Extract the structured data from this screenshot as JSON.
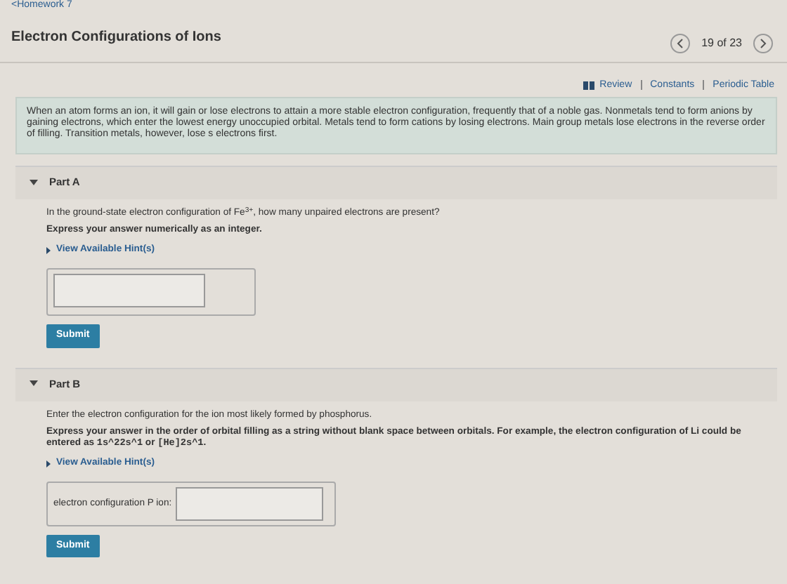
{
  "breadcrumb": "<Homework 7",
  "title": "Electron Configurations of Ions",
  "pager": {
    "position": "19 of 23"
  },
  "links": [
    {
      "label": "Review",
      "kind": "book"
    },
    {
      "label": "Constants",
      "kind": "plain"
    },
    {
      "label": "Periodic Table",
      "kind": "plain"
    }
  ],
  "intro": "When an atom forms an ion, it will gain or lose electrons to attain a more stable electron configuration, frequently that of a noble gas. Nonmetals tend to form anions by gaining electrons, which enter the lowest energy unoccupied orbital. Metals tend to form cations by losing electrons. Main group metals lose electrons in the reverse order of filling. Transition metals, however, lose s electrons first.",
  "parts": [
    {
      "title": "Part A",
      "expanded": true,
      "question": "In the ground-state electron configuration of Fe$^{3+}$, how many unpaired electrons are present?",
      "instruction": [
        {
          "kind": "text",
          "text": "Express your answer numerically as an integer."
        }
      ],
      "hint_link": "View Available Hint(s)",
      "submit": "Submit"
    },
    {
      "title": "Part B",
      "expanded": true,
      "question": "Enter the electron configuration for the ion most likely formed by phosphorus.",
      "instruction": [
        {
          "kind": "text",
          "text": "Express your answer in the order of orbital filling as a string without blank space between orbitals. For example, the electron configuration of Li could be entered as "
        },
        {
          "kind": "code",
          "text": "1s^22s^1"
        },
        {
          "kind": "text",
          "text": " or "
        },
        {
          "kind": "code",
          "text": "[He]2s^1"
        },
        {
          "kind": "text",
          "text": "."
        }
      ],
      "hint_link": "View Available Hint(s)",
      "answer_label": "electron configuration P ion:",
      "submit": "Submit"
    }
  ]
}
